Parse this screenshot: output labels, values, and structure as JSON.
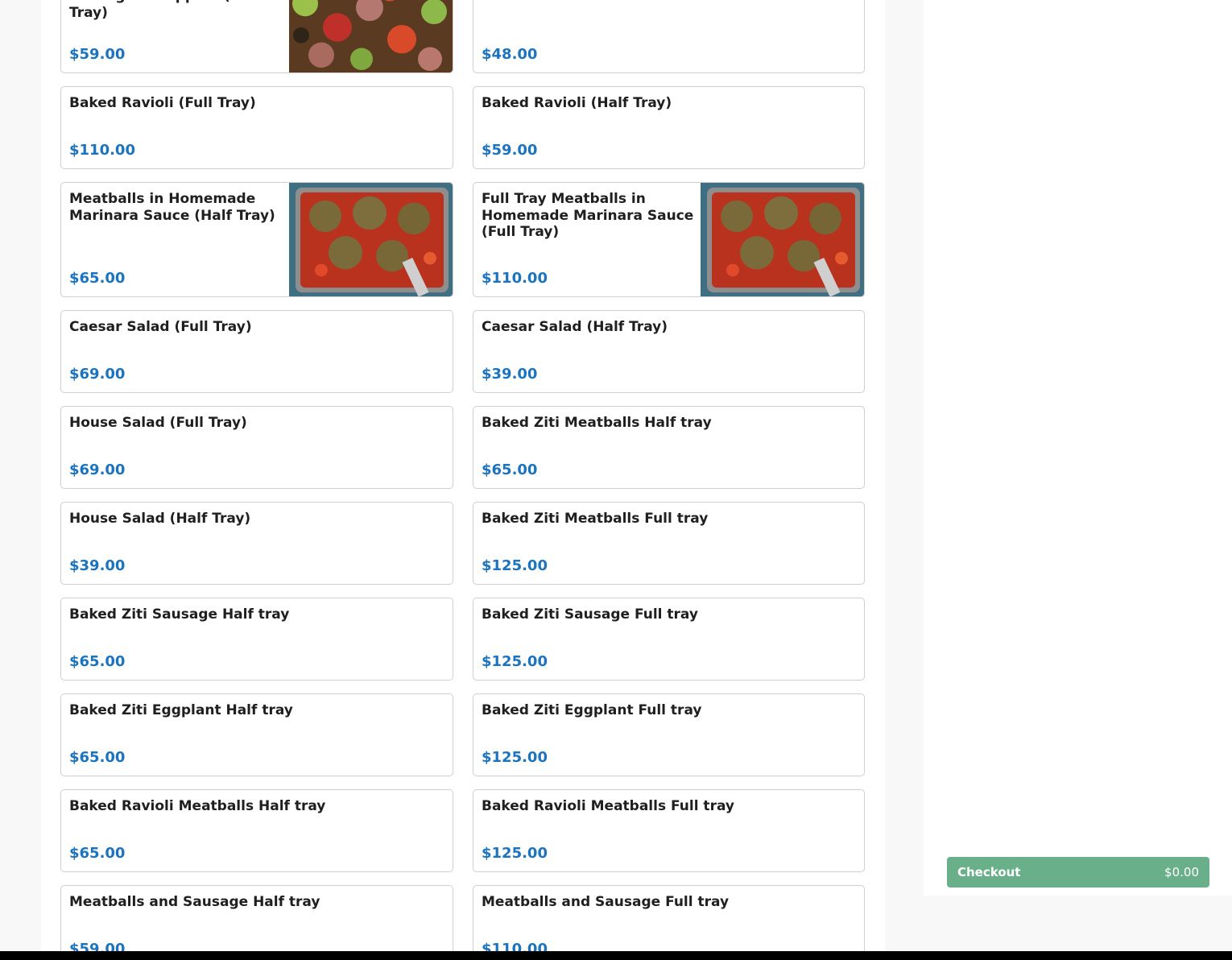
{
  "menu": {
    "items": [
      {
        "name": "Sausage & Peppers (Half Tray)",
        "price": "$59.00",
        "image": "sausage-peppers-photo"
      },
      {
        "name": "",
        "price": "$48.00"
      },
      {
        "name": "Baked Ravioli (Full Tray)",
        "price": "$110.00"
      },
      {
        "name": "Baked Ravioli (Half Tray)",
        "price": "$59.00"
      },
      {
        "name": "Meatballs in Homemade Marinara Sauce (Half Tray)",
        "price": "$65.00",
        "image": "meatballs-tray-photo"
      },
      {
        "name": "Full Tray Meatballs in Homemade Marinara Sauce (Full Tray)",
        "price": "$110.00",
        "image": "meatballs-tray-photo"
      },
      {
        "name": "Caesar Salad (Full Tray)",
        "price": "$69.00"
      },
      {
        "name": "Caesar Salad (Half Tray)",
        "price": "$39.00"
      },
      {
        "name": "House Salad (Full Tray)",
        "price": "$69.00"
      },
      {
        "name": "Baked Ziti Meatballs Half tray",
        "price": "$65.00"
      },
      {
        "name": "House Salad (Half Tray)",
        "price": "$39.00"
      },
      {
        "name": "Baked Ziti Meatballs Full tray",
        "price": "$125.00"
      },
      {
        "name": "Baked Ziti Sausage Half tray",
        "price": "$65.00"
      },
      {
        "name": "Baked Ziti Sausage Full tray",
        "price": "$125.00"
      },
      {
        "name": "Baked Ziti Eggplant Half tray",
        "price": "$65.00"
      },
      {
        "name": "Baked Ziti Eggplant Full tray",
        "price": "$125.00"
      },
      {
        "name": "Baked Ravioli Meatballs Half tray",
        "price": "$65.00"
      },
      {
        "name": "Baked Ravioli Meatballs Full tray",
        "price": "$125.00"
      },
      {
        "name": "Meatballs and Sausage Half tray",
        "price": "$59.00"
      },
      {
        "name": "Meatballs and Sausage Full tray",
        "price": "$110.00"
      }
    ]
  },
  "cart": {
    "checkout_label": "Checkout",
    "total": "$0.00",
    "button_color": "#69b08a"
  },
  "colors": {
    "price": "#1c73be"
  }
}
